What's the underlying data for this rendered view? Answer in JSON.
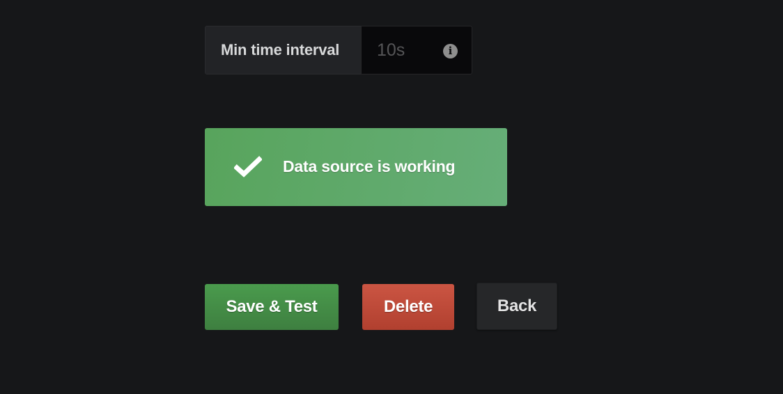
{
  "settings": {
    "min_time_interval": {
      "label": "Min time interval",
      "placeholder": "10s",
      "value": "",
      "icon": "info-icon"
    }
  },
  "alert": {
    "icon": "check-icon",
    "message": "Data source is working",
    "color": "#5fa968"
  },
  "actions": {
    "save_test_label": "Save & Test",
    "delete_label": "Delete",
    "back_label": "Back",
    "colors": {
      "save": "#45904a",
      "delete": "#c14b3a",
      "back": "#262729"
    }
  }
}
